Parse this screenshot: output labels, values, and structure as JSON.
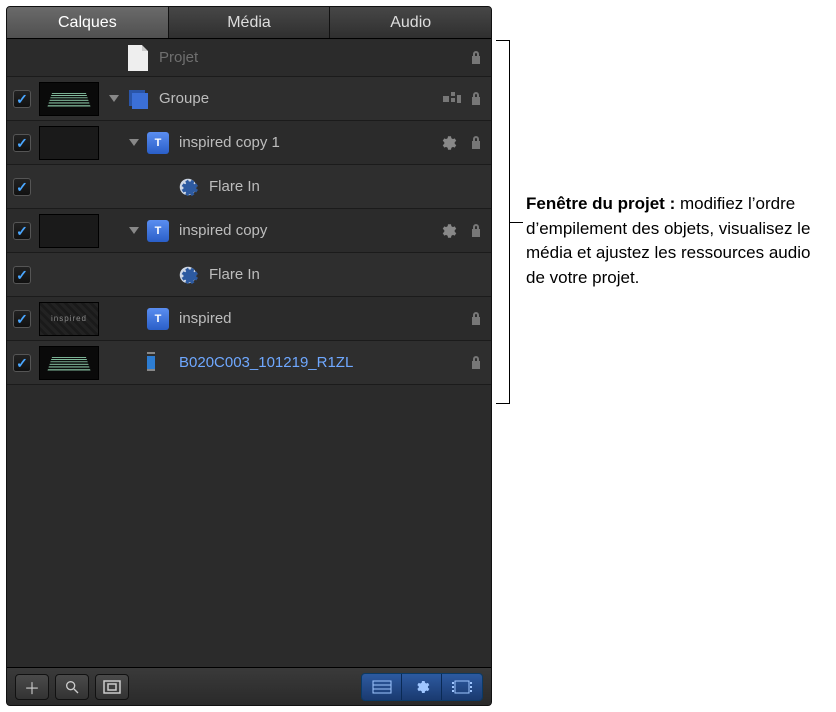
{
  "tabs": {
    "t0": "Calques",
    "t1": "Média",
    "t2": "Audio",
    "activeIndex": 0
  },
  "rows": {
    "project": "Projet",
    "group": "Groupe",
    "item1": "inspired copy 1",
    "flare1": "Flare In",
    "item2": "inspired copy",
    "flare2": "Flare In",
    "item3": "inspired",
    "clip": "B020C003_101219_R1ZL"
  },
  "annotation": {
    "title": "Fenêtre du projet : ",
    "body": "modifiez l’ordre d’empilement des objets, visualisez le média et ajustez les ressources audio de votre projet."
  }
}
